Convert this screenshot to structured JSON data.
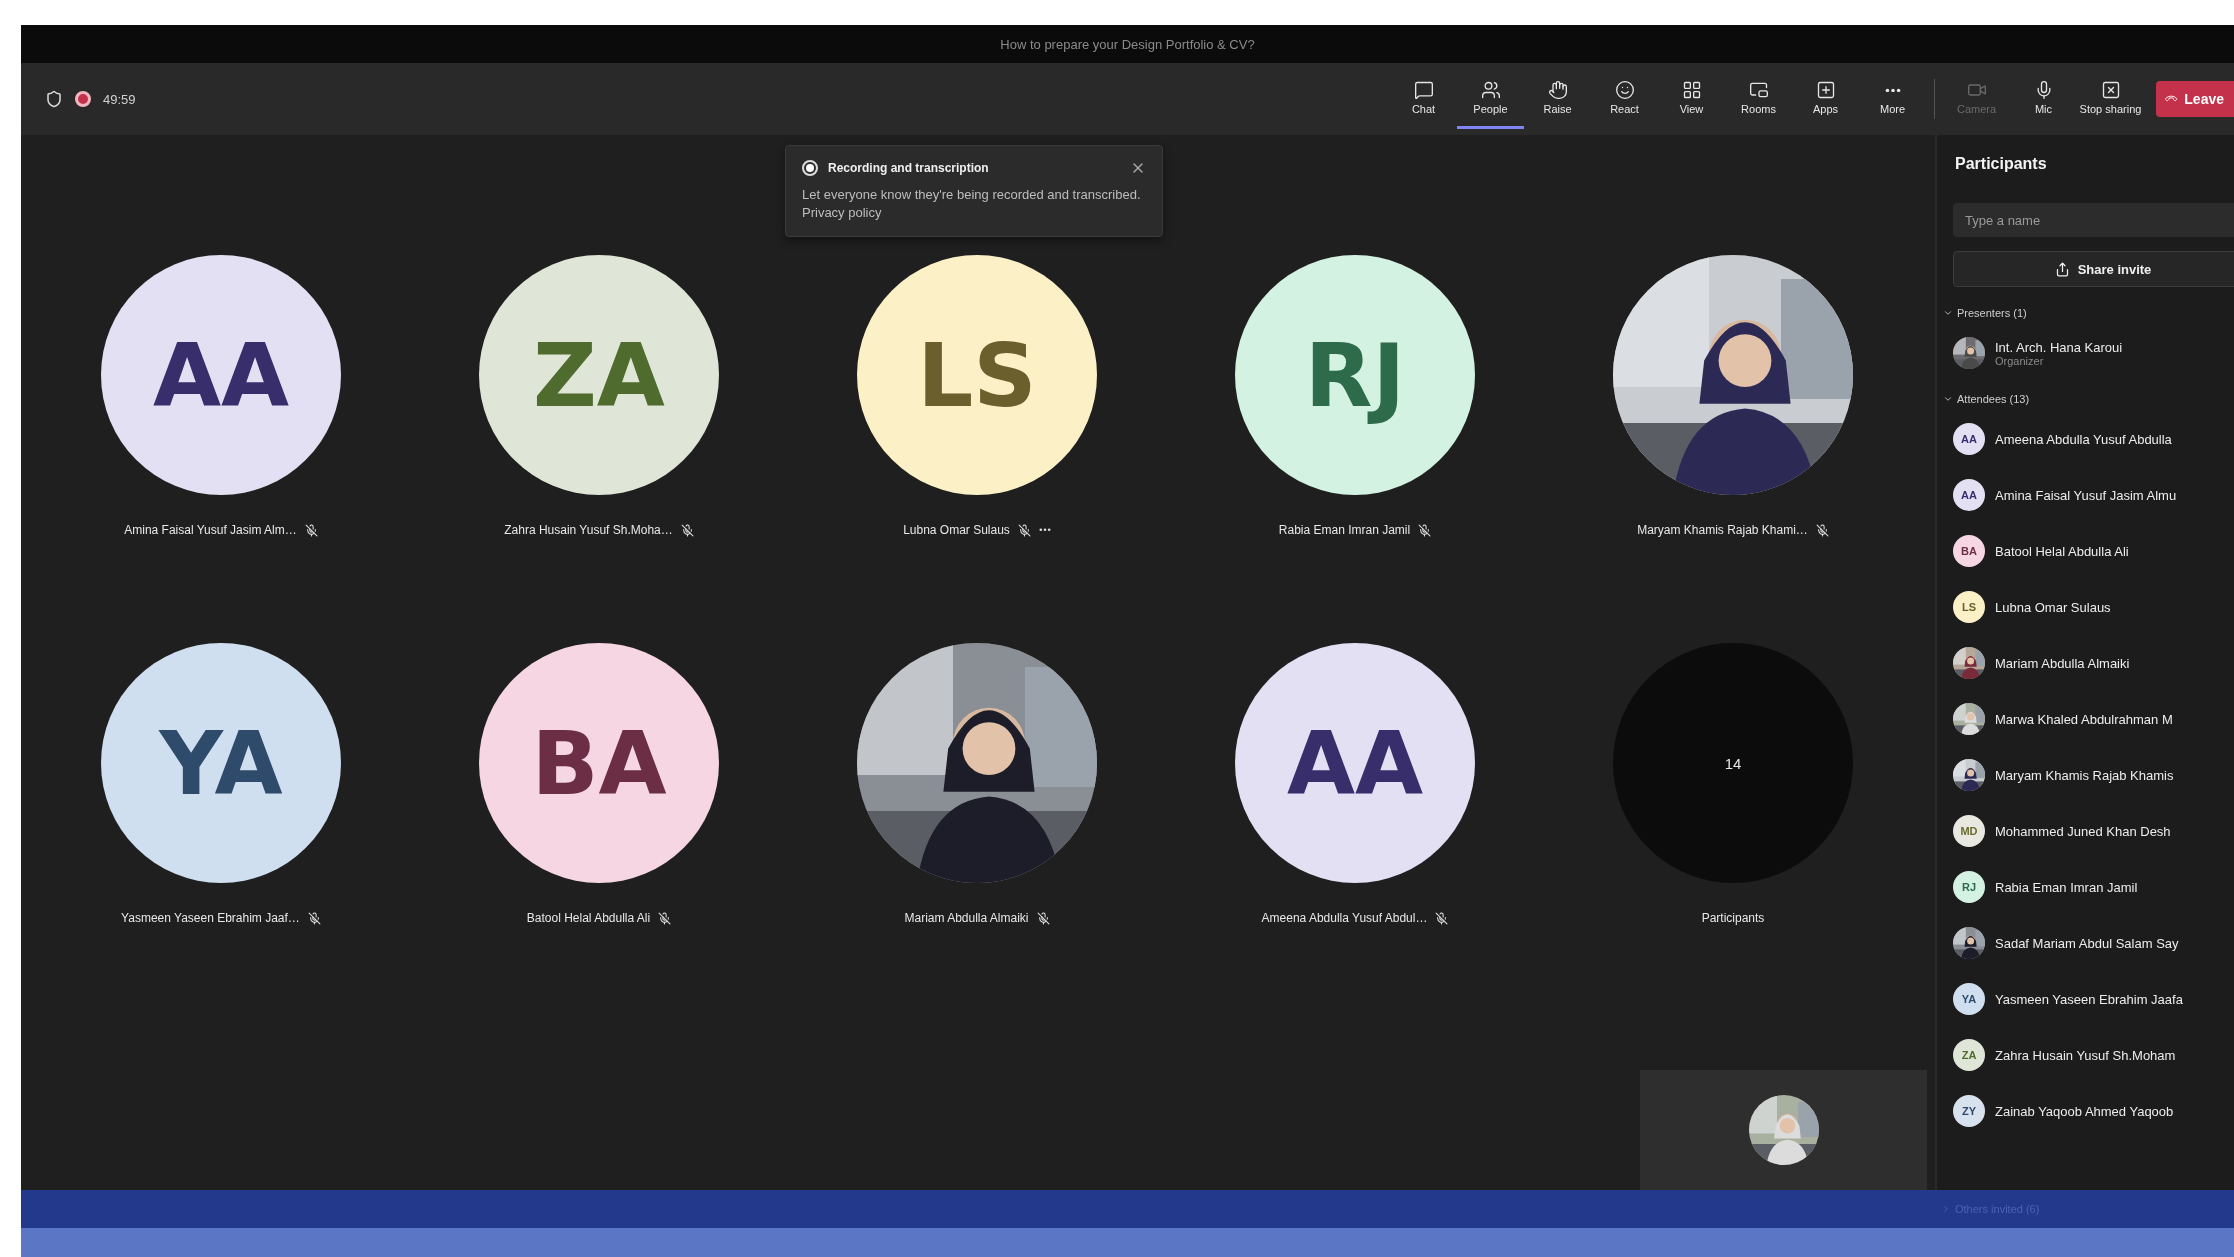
{
  "title_bar": {
    "title": "How to prepare your Design Portfolio & CV?"
  },
  "meeting_info": {
    "protected": true,
    "recording": true,
    "timer": "49:59"
  },
  "toolbar": {
    "buttons": [
      {
        "kind": "chat",
        "label": "Chat",
        "selected": false,
        "disabled": false
      },
      {
        "kind": "people",
        "label": "People",
        "selected": true,
        "disabled": false
      },
      {
        "kind": "raise",
        "label": "Raise",
        "selected": false,
        "disabled": false
      },
      {
        "kind": "react",
        "label": "React",
        "selected": false,
        "disabled": false
      },
      {
        "kind": "view",
        "label": "View",
        "selected": false,
        "disabled": false
      },
      {
        "kind": "rooms",
        "label": "Rooms",
        "selected": false,
        "disabled": false
      },
      {
        "kind": "apps",
        "label": "Apps",
        "selected": false,
        "disabled": false
      },
      {
        "kind": "more",
        "label": "More",
        "selected": false,
        "disabled": false
      }
    ],
    "media_buttons": [
      {
        "kind": "camera",
        "label": "Camera",
        "selected": false,
        "disabled": true
      },
      {
        "kind": "mic",
        "label": "Mic",
        "selected": false,
        "disabled": false
      },
      {
        "kind": "share",
        "label": "Stop sharing",
        "selected": false,
        "disabled": false
      }
    ],
    "leave_button": {
      "label": "Leave"
    }
  },
  "toast": {
    "title": "Recording and transcription",
    "body": "Let everyone know they're being recorded and transcribed.",
    "link": "Privacy policy"
  },
  "tiles": [
    {
      "kind": "initials",
      "initials": "AA",
      "color": "#e3e0f3",
      "name": "Amina Faisal Yusuf Jasim Alm…",
      "muted": true,
      "more": false
    },
    {
      "kind": "initials",
      "initials": "ZA",
      "color": "#dfe6d7",
      "name": "Zahra Husain Yusuf Sh.Moha…",
      "muted": true,
      "more": false
    },
    {
      "kind": "initials",
      "initials": "LS",
      "color": "#fbf0c6",
      "name": "Lubna Omar Sulaus",
      "muted": true,
      "more": true
    },
    {
      "kind": "initials",
      "initials": "RJ",
      "color": "#d3f2e2",
      "name": "Rabia Eman Imran Jamil",
      "muted": true,
      "more": false
    },
    {
      "kind": "picture",
      "name": "Maryam Khamis Rajab Khami…",
      "muted": true,
      "more": false
    },
    {
      "kind": "initials",
      "initials": "YA",
      "color": "#cfdff0",
      "name": "Yasmeen Yaseen Ebrahim Jaaf…",
      "muted": true,
      "more": false
    },
    {
      "kind": "initials",
      "initials": "BA",
      "color": "#f6d6e2",
      "name": "Batool Helal Abdulla Ali",
      "muted": true,
      "more": false
    },
    {
      "kind": "picture",
      "name": "Mariam Abdulla Almaiki",
      "muted": true,
      "more": false
    },
    {
      "kind": "initials",
      "initials": "AA",
      "color": "#e3e0f3",
      "name": "Ameena Abdulla Yusuf Abdul…",
      "muted": true,
      "more": false
    },
    {
      "kind": "overflow",
      "count": "14",
      "name": "Participants",
      "muted": false,
      "more": false
    }
  ],
  "participants_panel": {
    "title": "Participants",
    "search": {
      "placeholder": "Type a name"
    },
    "share_button": "Share invite",
    "sections": [
      {
        "label": "Presenters (1)",
        "expanded": true,
        "members": [
          {
            "kind": "picture",
            "name": "Int. Arch. Hana Karoui",
            "role": "Organizer"
          }
        ]
      },
      {
        "label": "Attendees (13)",
        "expanded": true,
        "members": [
          {
            "kind": "initials",
            "initials": "AA",
            "color": "#e3e0f3",
            "name": "Ameena Abdulla Yusuf Abdulla"
          },
          {
            "kind": "initials",
            "initials": "AA",
            "color": "#e3e0f3",
            "name": "Amina Faisal Yusuf Jasim Almu"
          },
          {
            "kind": "initials",
            "initials": "BA",
            "color": "#f6d6e2",
            "name": "Batool Helal Abdulla Ali"
          },
          {
            "kind": "initials",
            "initials": "LS",
            "color": "#fbf0c6",
            "name": "Lubna Omar Sulaus"
          },
          {
            "kind": "picture",
            "name": "Mariam Abdulla Almaiki"
          },
          {
            "kind": "picture",
            "name": "Marwa Khaled Abdulrahman M"
          },
          {
            "kind": "picture",
            "name": "Maryam Khamis Rajab Khamis"
          },
          {
            "kind": "initials",
            "initials": "MD",
            "color": "#e8e8e0",
            "name": "Mohammed Juned Khan Desh"
          },
          {
            "kind": "initials",
            "initials": "RJ",
            "color": "#d3f2e2",
            "name": "Rabia Eman Imran Jamil"
          },
          {
            "kind": "picture",
            "name": "Sadaf Mariam Abdul Salam Say"
          },
          {
            "kind": "initials",
            "initials": "YA",
            "color": "#cfdff0",
            "name": "Yasmeen Yaseen Ebrahim Jaafa"
          },
          {
            "kind": "initials",
            "initials": "ZA",
            "color": "#dfe6d7",
            "name": "Zahra Husain Yusuf Sh.Moham"
          },
          {
            "kind": "initials",
            "initials": "ZY",
            "color": "#d8e2ee",
            "name": "Zainab Yaqoob Ahmed Yaqoob"
          }
        ]
      }
    ],
    "collapsed_section": {
      "label": "Others invited (6)",
      "expanded": false
    }
  }
}
